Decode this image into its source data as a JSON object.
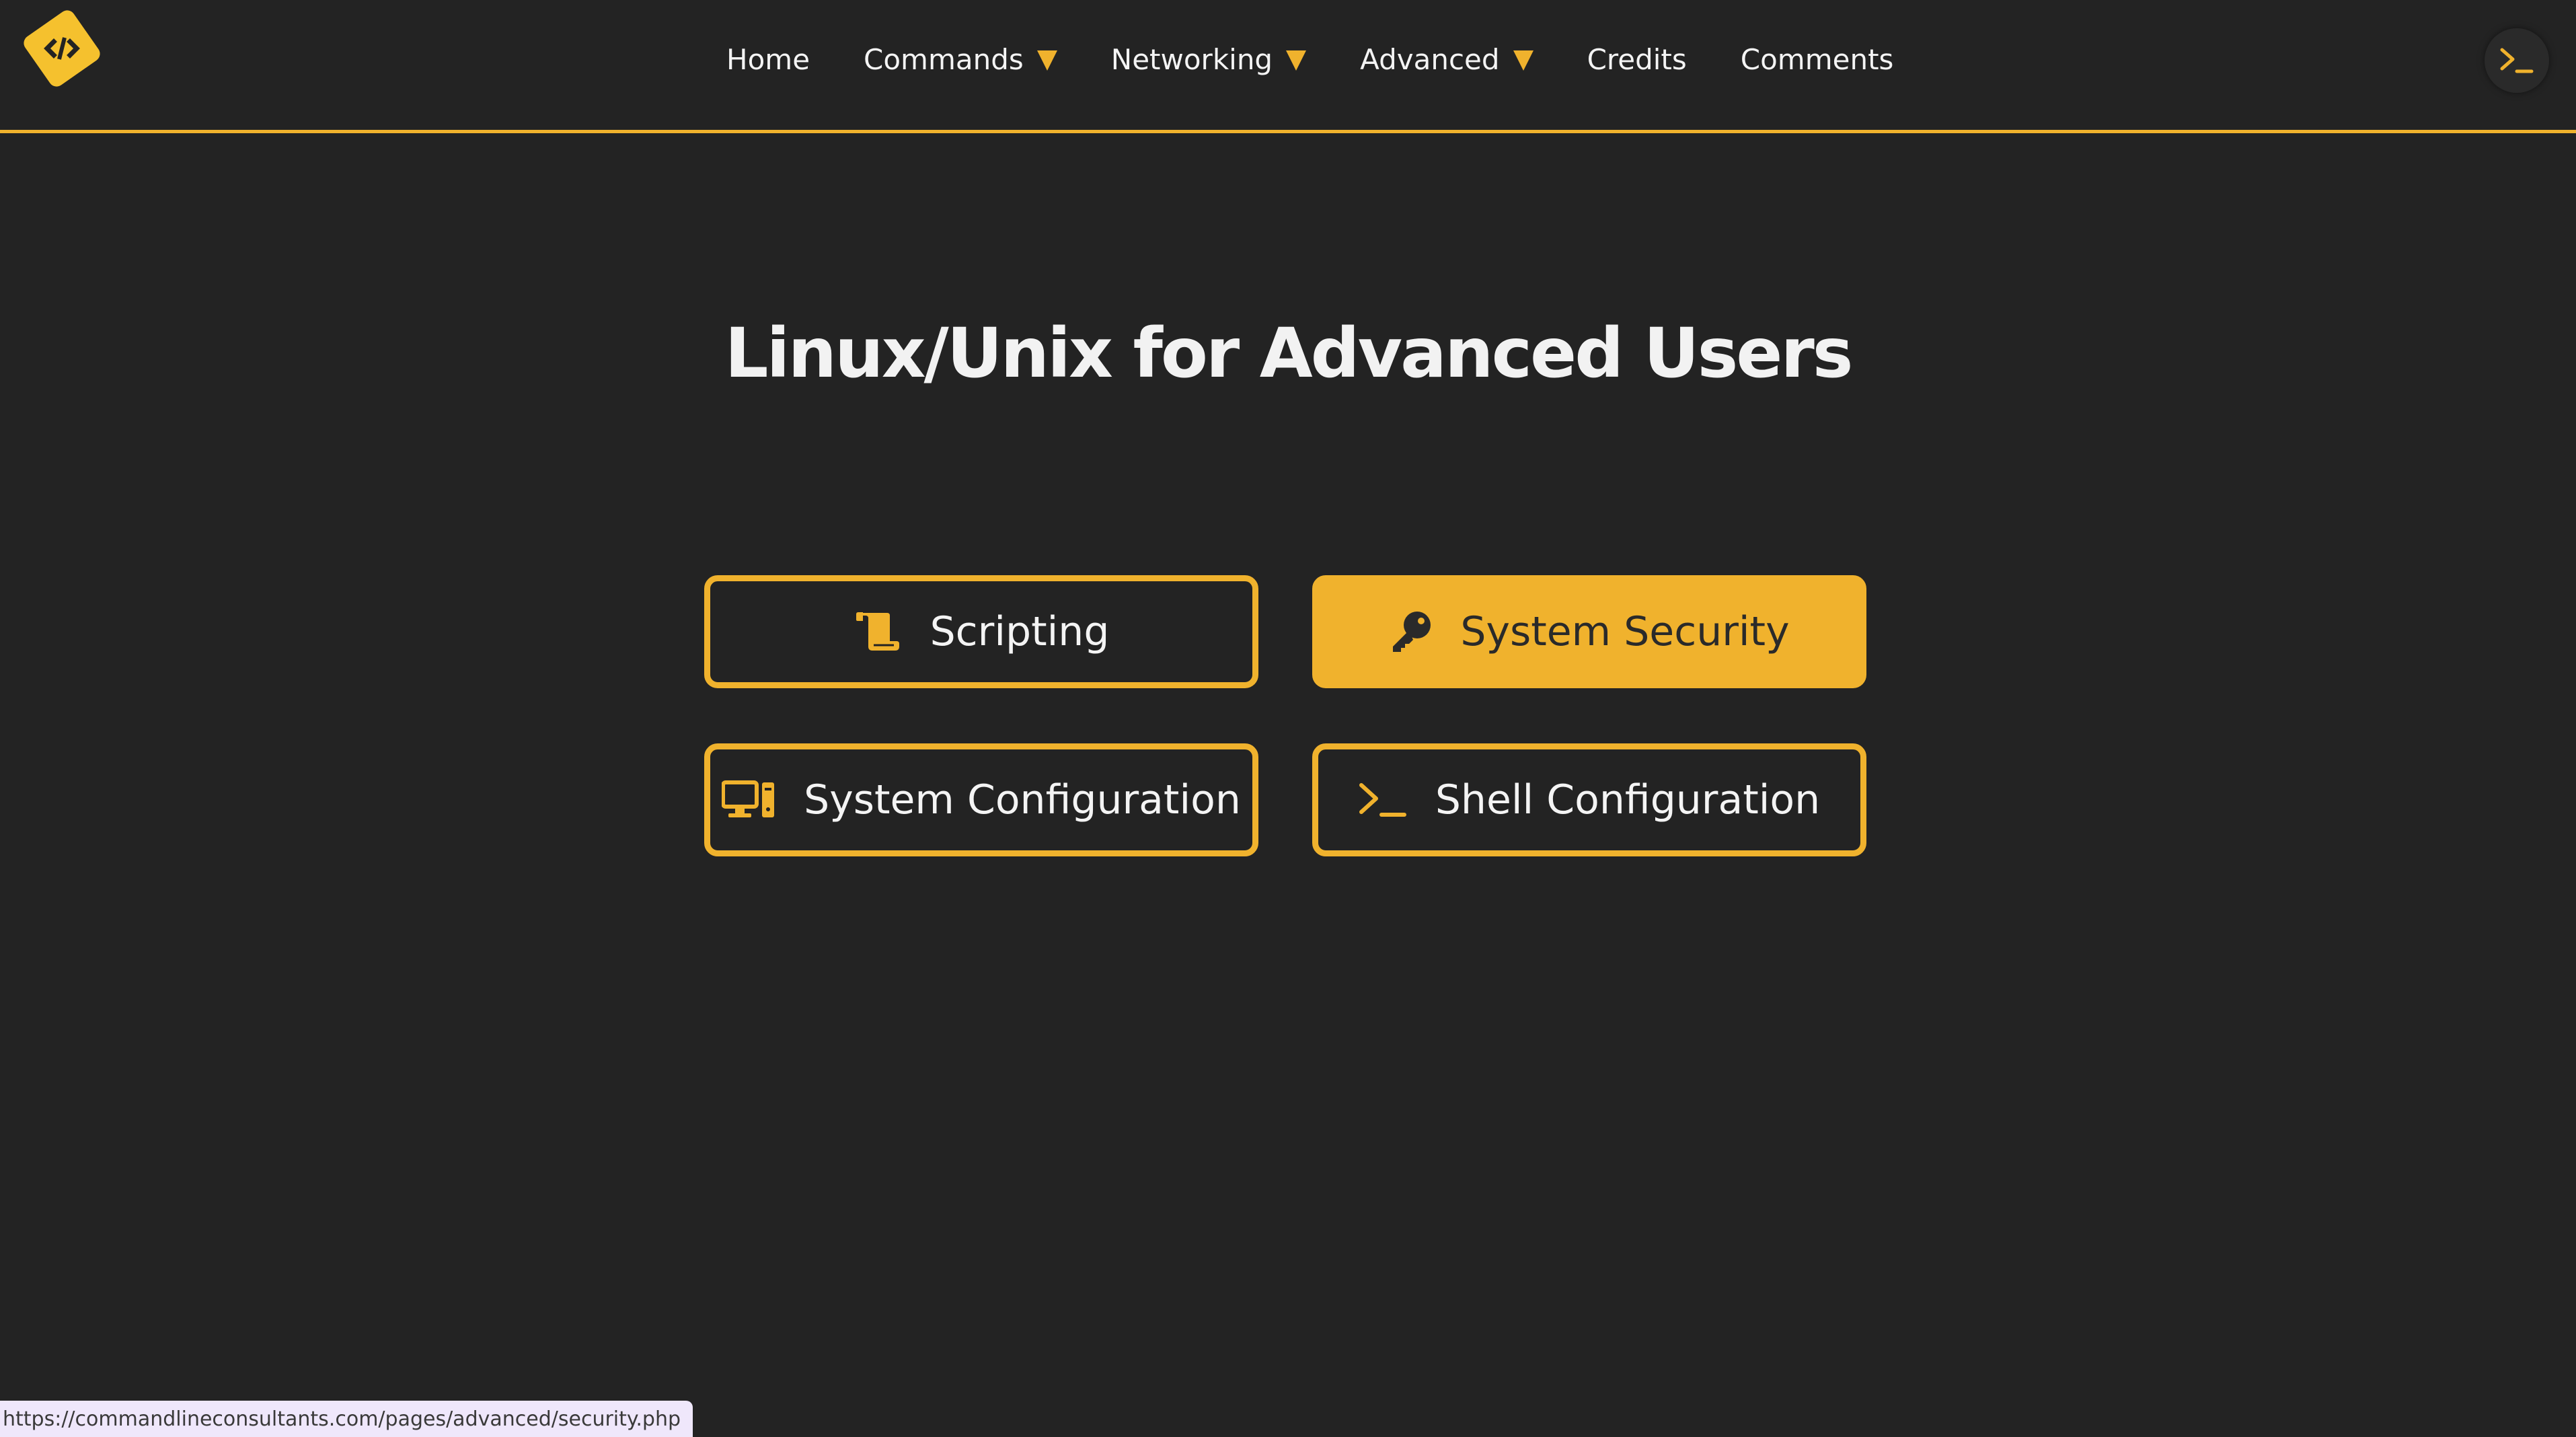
{
  "header": {
    "nav": [
      {
        "label": "Home",
        "dropdown": false
      },
      {
        "label": "Commands",
        "dropdown": true
      },
      {
        "label": "Networking",
        "dropdown": true
      },
      {
        "label": "Advanced",
        "dropdown": true
      },
      {
        "label": "Credits",
        "dropdown": false
      },
      {
        "label": "Comments",
        "dropdown": false
      }
    ],
    "logo_icon": "code-brackets-icon",
    "terminal_icon": "terminal-prompt-icon"
  },
  "main": {
    "title": "Linux/Unix for Advanced Users",
    "cards": [
      {
        "label": "Scripting",
        "icon": "scroll-icon",
        "active": false
      },
      {
        "label": "System Security",
        "icon": "key-icon",
        "active": true
      },
      {
        "label": "System Configuration",
        "icon": "desktop-computer-icon",
        "active": false
      },
      {
        "label": "Shell Configuration",
        "icon": "terminal-prompt-icon",
        "active": false
      }
    ]
  },
  "status_bar": {
    "url": "https://commandlineconsultants.com/pages/advanced/security.php"
  },
  "colors": {
    "background": "#232323",
    "accent": "#f0b22d",
    "text": "#f2f2f2"
  }
}
